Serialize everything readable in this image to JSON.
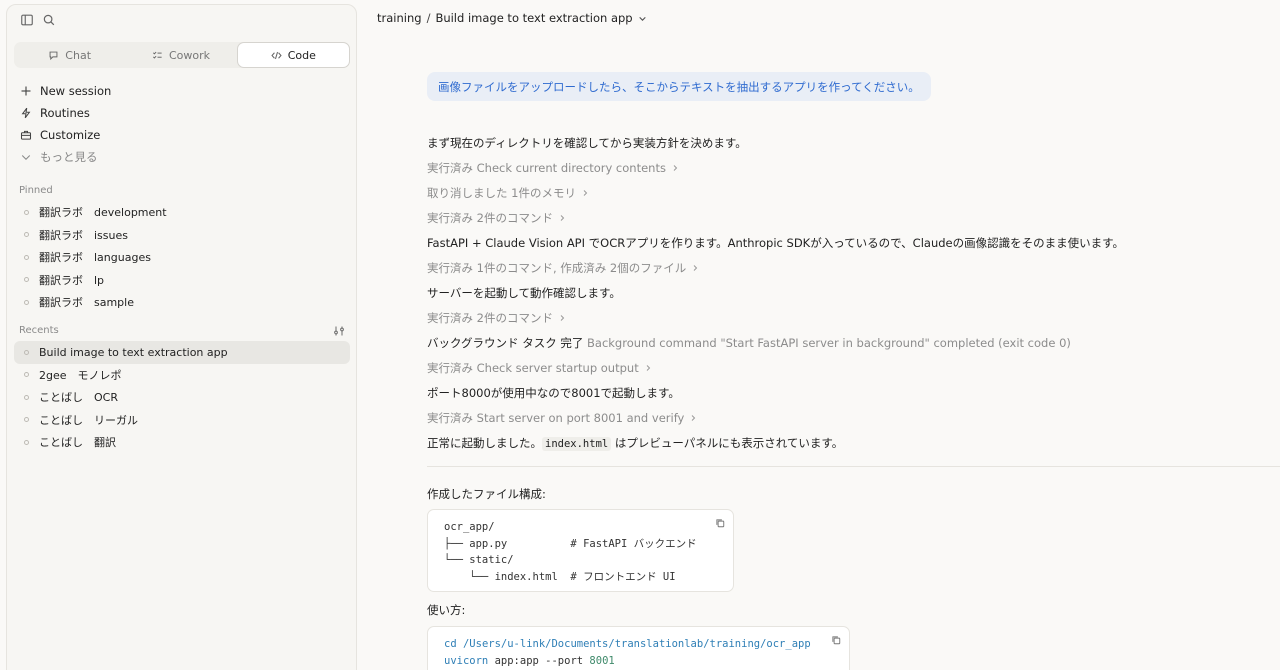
{
  "sidebar": {
    "mode_tabs": [
      {
        "label": "Chat",
        "icon": "chat-icon",
        "active": false
      },
      {
        "label": "Cowork",
        "icon": "cowork-icon",
        "active": false
      },
      {
        "label": "Code",
        "icon": "code-icon",
        "active": true
      }
    ],
    "menu": [
      {
        "label": "New session",
        "icon": "plus-icon"
      },
      {
        "label": "Routines",
        "icon": "routines-icon"
      },
      {
        "label": "Customize",
        "icon": "briefcase-icon"
      },
      {
        "label": "もっと見る",
        "icon": "chevron-down-icon"
      }
    ],
    "pinned_label": "Pinned",
    "pinned": [
      {
        "label": "翻訳ラボ　development"
      },
      {
        "label": "翻訳ラボ　issues"
      },
      {
        "label": "翻訳ラボ　languages"
      },
      {
        "label": "翻訳ラボ　lp"
      },
      {
        "label": "翻訳ラボ　sample"
      }
    ],
    "recents_label": "Recents",
    "recents": [
      {
        "label": "Build image to text extraction app",
        "active": true
      },
      {
        "label": "2gee　モノレポ",
        "active": false
      },
      {
        "label": "ことばし　OCR",
        "active": false
      },
      {
        "label": "ことばし　リーガル",
        "active": false
      },
      {
        "label": "ことばし　翻訳",
        "active": false
      }
    ]
  },
  "breadcrumb": {
    "project": "training",
    "separator": "/",
    "session": "Build image to text extraction app"
  },
  "conversation": {
    "user_message": "画像ファイルをアップロードしたら、そこからテキストを抽出するアプリを作ってください。",
    "lines": {
      "l1": "まず現在のディレクトリを確認してから実装方針を決めます。",
      "l2": "実行済み Check current directory contents",
      "l3": "取り消しました 1件のメモリ",
      "l4": "実行済み 2件のコマンド",
      "l5": "FastAPI + Claude Vision API でOCRアプリを作ります。Anthropic SDKが入っているので、Claudeの画像認識をそのまま使います。",
      "l6": "実行済み 1件のコマンド, 作成済み 2個のファイル",
      "l7": "サーバーを起動して動作確認します。",
      "l8": "実行済み 2件のコマンド",
      "l9_main": "バックグラウンド タスク 完了",
      "l9_detail": "Background command \"Start FastAPI server in background\" completed (exit code 0)",
      "l10": "実行済み Check server startup output",
      "l11": "ポート8000が使用中なので8001で起動します。",
      "l12": "実行済み Start server on port 8001 and verify",
      "l13_pre": "正常に起動しました。",
      "l13_code": "index.html",
      "l13_post": " はプレビューパネルにも表示されています。"
    },
    "files_heading": "作成したファイル構成:",
    "tree_lines": [
      "ocr_app/",
      "├── app.py          # FastAPI バックエンド",
      "└── static/",
      "    └── index.html  # フロントエンド UI"
    ],
    "usage_heading": "使い方:",
    "usage_cmd1_kw": "cd",
    "usage_cmd1_arg": "/Users/u-link/Documents/translationlab/training/ocr_app",
    "usage_cmd2_kw": "uvicorn",
    "usage_cmd2_mid": " app:app --port ",
    "usage_cmd2_num": "8001"
  }
}
